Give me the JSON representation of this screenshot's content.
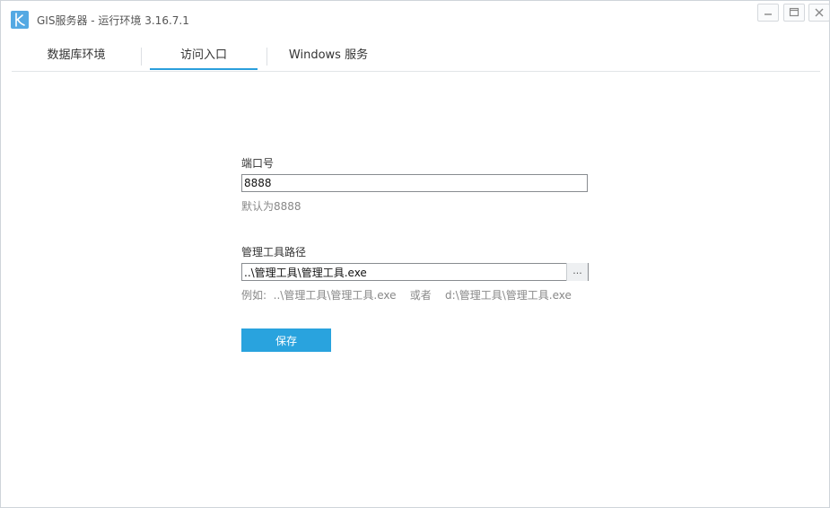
{
  "window": {
    "title": "GIS服务器 - 运行环境 3.16.7.1",
    "app_icon": "k-logo-icon",
    "controls": [
      "minimize-icon",
      "maximize-icon",
      "close-icon"
    ]
  },
  "tabs": [
    {
      "label": "数据库环境",
      "active": false
    },
    {
      "label": "访问入口",
      "active": true
    },
    {
      "label": "Windows 服务",
      "active": false
    }
  ],
  "form": {
    "port": {
      "label": "端口号",
      "value": "8888",
      "hint": "默认为8888"
    },
    "tool_path": {
      "label": "管理工具路径",
      "value": "..\\管理工具\\管理工具.exe",
      "browse_label": "...",
      "hint": "例如:  ..\\管理工具\\管理工具.exe    或者    d:\\管理工具\\管理工具.exe"
    },
    "save_label": "保存"
  },
  "colors": {
    "accent": "#29a3de",
    "app_icon_bg": "#54a9e3",
    "hint_text": "#888888"
  }
}
